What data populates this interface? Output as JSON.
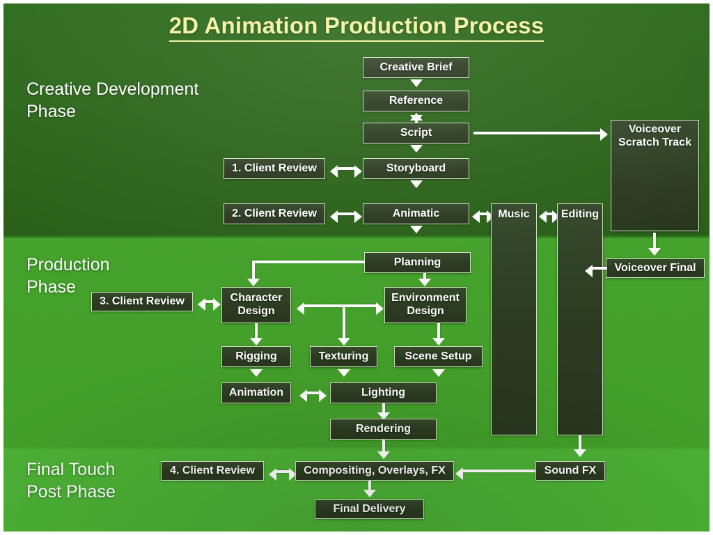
{
  "title": "2D Animation Production Process",
  "theme": {
    "band_top": "#2a6019",
    "band_mid": "#43a02a",
    "band_bottom": "#4bb034",
    "title_color": "#f2f3a0",
    "box_fill": "#2c3b21",
    "box_border": "#cfe3c0",
    "text_color": "#ffffff",
    "connector_color": "#ffffff"
  },
  "phases": [
    {
      "id": "creative",
      "label": "Creative Development\nPhase"
    },
    {
      "id": "production",
      "label": "Production\nPhase"
    },
    {
      "id": "post",
      "label": "Final Touch\nPost Phase"
    }
  ],
  "nodes": {
    "creative_brief": "Creative Brief",
    "reference": "Reference",
    "script": "Script",
    "storyboard": "Storyboard",
    "animatic": "Animatic",
    "client_review_1": "1. Client Review",
    "client_review_2": "2. Client Review",
    "client_review_3": "3. Client Review",
    "client_review_4": "4. Client Review",
    "voiceover_scratch": "Voiceover\nScratch Track",
    "voiceover_final": "Voiceover Final",
    "music": "Music",
    "editing": "Editing",
    "planning": "Planning",
    "character_design": "Character\nDesign",
    "environment_design": "Environment\nDesign",
    "rigging": "Rigging",
    "texturing": "Texturing",
    "scene_setup": "Scene Setup",
    "animation": "Animation",
    "lighting": "Lighting",
    "rendering": "Rendering",
    "compositing": "Compositing, Overlays, FX",
    "sound_fx": "Sound FX",
    "final_delivery": "Final Delivery"
  },
  "flow": {
    "sequence_main": [
      "Creative Brief",
      "Reference",
      "Script",
      "Storyboard",
      "Animatic",
      "Planning",
      "Character Design",
      "Environment Design",
      "Rigging",
      "Texturing",
      "Scene Setup",
      "Animation",
      "Lighting",
      "Rendering",
      "Compositing, Overlays, FX",
      "Final Delivery"
    ],
    "edges": [
      {
        "from": "Creative Brief",
        "to": "Reference",
        "type": "arrow-down"
      },
      {
        "from": "Reference",
        "to": "Script",
        "type": "double-vertical"
      },
      {
        "from": "Script",
        "to": "Storyboard",
        "type": "arrow-down"
      },
      {
        "from": "Script",
        "to": "Voiceover Scratch Track",
        "type": "arrow-right"
      },
      {
        "from": "1. Client Review",
        "to": "Storyboard",
        "type": "double-horizontal"
      },
      {
        "from": "Storyboard",
        "to": "Animatic",
        "type": "arrow-down"
      },
      {
        "from": "2. Client Review",
        "to": "Animatic",
        "type": "double-horizontal"
      },
      {
        "from": "Animatic",
        "to": "Music",
        "type": "double-horizontal"
      },
      {
        "from": "Music",
        "to": "Editing",
        "type": "double-horizontal"
      },
      {
        "from": "Voiceover Scratch Track",
        "to": "Voiceover Final",
        "type": "arrow-down"
      },
      {
        "from": "Voiceover Final",
        "to": "Editing",
        "type": "arrow-left"
      },
      {
        "from": "Animatic",
        "to": "Planning",
        "type": "arrow-down"
      },
      {
        "from": "Planning",
        "to": "Character Design",
        "type": "elbow-left-down"
      },
      {
        "from": "Planning",
        "to": "Environment Design",
        "type": "arrow-down"
      },
      {
        "from": "3. Client Review",
        "to": "Character Design",
        "type": "double-horizontal"
      },
      {
        "from": "Character Design",
        "to": "Environment Design",
        "type": "double-horizontal"
      },
      {
        "from": "Character Design / Environment Design",
        "to": "Texturing",
        "type": "tee-down"
      },
      {
        "from": "Character Design",
        "to": "Rigging",
        "type": "arrow-down"
      },
      {
        "from": "Environment Design",
        "to": "Scene Setup",
        "type": "arrow-down"
      },
      {
        "from": "Rigging",
        "to": "Animation",
        "type": "arrow-down"
      },
      {
        "from": "Texturing",
        "to": "Lighting",
        "type": "arrow-down"
      },
      {
        "from": "Scene Setup",
        "to": "Lighting",
        "type": "arrow-down"
      },
      {
        "from": "Animation",
        "to": "Lighting",
        "type": "double-horizontal"
      },
      {
        "from": "Lighting",
        "to": "Rendering",
        "type": "arrow-down"
      },
      {
        "from": "Rendering",
        "to": "Compositing, Overlays, FX",
        "type": "arrow-down"
      },
      {
        "from": "4. Client Review",
        "to": "Compositing, Overlays, FX",
        "type": "double-horizontal"
      },
      {
        "from": "Editing",
        "to": "Sound FX",
        "type": "arrow-down"
      },
      {
        "from": "Sound FX",
        "to": "Compositing, Overlays, FX",
        "type": "arrow-left"
      },
      {
        "from": "Compositing, Overlays, FX",
        "to": "Final Delivery",
        "type": "arrow-down"
      }
    ]
  }
}
